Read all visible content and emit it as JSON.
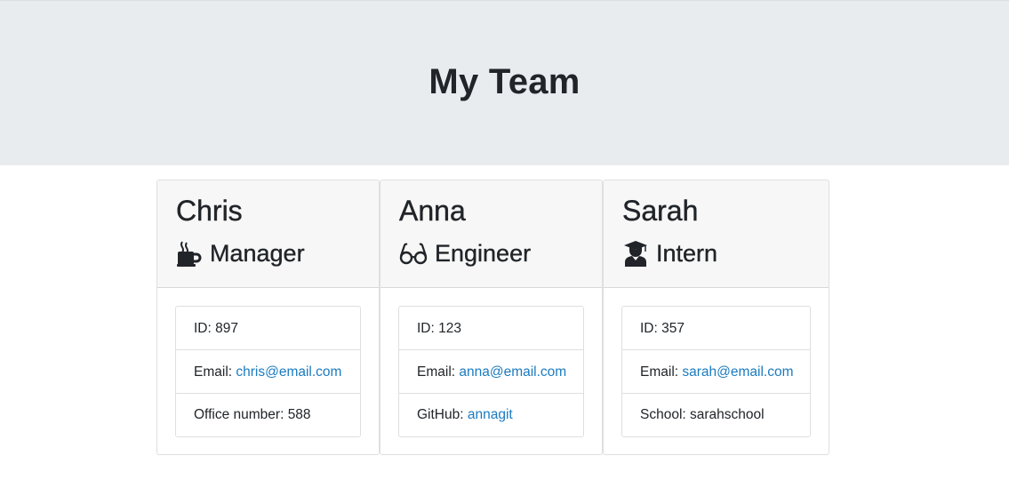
{
  "header": {
    "title": "My Team"
  },
  "colors": {
    "jumbotron_bg": "#e9ecef",
    "link": "#1b7bbf",
    "card_header_bg": "#f7f7f7"
  },
  "team": [
    {
      "name": "Chris",
      "role": "Manager",
      "icon": "coffee-mug-icon",
      "id_label": "ID: ",
      "id": "897",
      "email_label": "Email: ",
      "email": "chris@email.com",
      "extra_label": "Office number: ",
      "extra_value": "588"
    },
    {
      "name": "Anna",
      "role": "Engineer",
      "icon": "glasses-icon",
      "id_label": "ID: ",
      "id": "123",
      "email_label": "Email: ",
      "email": "anna@email.com",
      "extra_label": "GitHub: ",
      "extra_value": "annagit"
    },
    {
      "name": "Sarah",
      "role": "Intern",
      "icon": "graduate-icon",
      "id_label": "ID: ",
      "id": "357",
      "email_label": "Email: ",
      "email": "sarah@email.com",
      "extra_label": "School: ",
      "extra_value": "sarahschool"
    }
  ]
}
